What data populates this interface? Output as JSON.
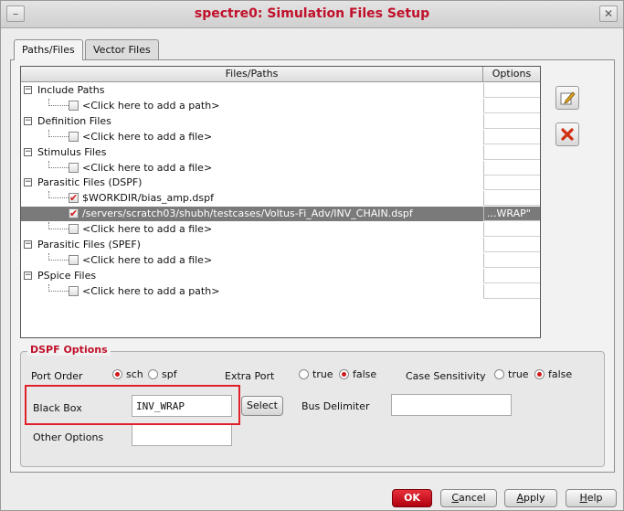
{
  "window": {
    "title": "spectre0: Simulation Files Setup"
  },
  "tabs": [
    {
      "label": "Paths/Files",
      "active": true
    },
    {
      "label": "Vector Files",
      "active": false
    }
  ],
  "tree": {
    "columns": {
      "files": "Files/Paths",
      "options": "Options"
    },
    "groups": [
      {
        "label": "Include Paths",
        "items": [
          {
            "text": "<Click here to add a path>",
            "checked": false,
            "option": ""
          }
        ]
      },
      {
        "label": "Definition Files",
        "items": [
          {
            "text": "<Click here to add a file>",
            "checked": false,
            "option": ""
          }
        ]
      },
      {
        "label": "Stimulus Files",
        "items": [
          {
            "text": "<Click here to add a file>",
            "checked": false,
            "option": ""
          }
        ]
      },
      {
        "label": "Parasitic Files (DSPF)",
        "items": [
          {
            "text": "$WORKDIR/bias_amp.dspf",
            "checked": true,
            "option": ""
          },
          {
            "text": "/servers/scratch03/shubh/testcases/Voltus-Fi_Adv/INV_CHAIN.dspf",
            "checked": true,
            "option": "...WRAP\"",
            "selected": true
          },
          {
            "text": "<Click here to add a file>",
            "checked": false,
            "option": ""
          }
        ]
      },
      {
        "label": "Parasitic Files (SPEF)",
        "items": [
          {
            "text": "<Click here to add a file>",
            "checked": false,
            "option": ""
          }
        ]
      },
      {
        "label": "PSpice Files",
        "items": [
          {
            "text": "<Click here to add a path>",
            "checked": false,
            "option": ""
          }
        ]
      }
    ]
  },
  "side_buttons": [
    {
      "icon": "edit-icon",
      "color": "#e0a020"
    },
    {
      "icon": "delete-icon",
      "color": "#d03010"
    }
  ],
  "dspf_options": {
    "legend": "DSPF Options",
    "port_order": {
      "label": "Port Order",
      "opt1": "sch",
      "opt2": "spf",
      "selected": "sch"
    },
    "extra_port": {
      "label": "Extra Port",
      "opt1": "true",
      "opt2": "false",
      "selected": "false"
    },
    "case_sensitivity": {
      "label": "Case Sensitivity",
      "opt1": "true",
      "opt2": "false",
      "selected": "false"
    },
    "black_box": {
      "label": "Black Box",
      "value": "INV_WRAP",
      "select_label": "Select"
    },
    "bus_delimiter": {
      "label": "Bus Delimiter",
      "value": ""
    },
    "other_options": {
      "label": "Other Options",
      "value": ""
    }
  },
  "footer": {
    "ok": "OK",
    "cancel": "Cancel",
    "apply": "Apply",
    "help": "Help"
  },
  "colors": {
    "accent": "#c0102a",
    "highlight_box": "#e0202a",
    "check": "#d01818"
  }
}
